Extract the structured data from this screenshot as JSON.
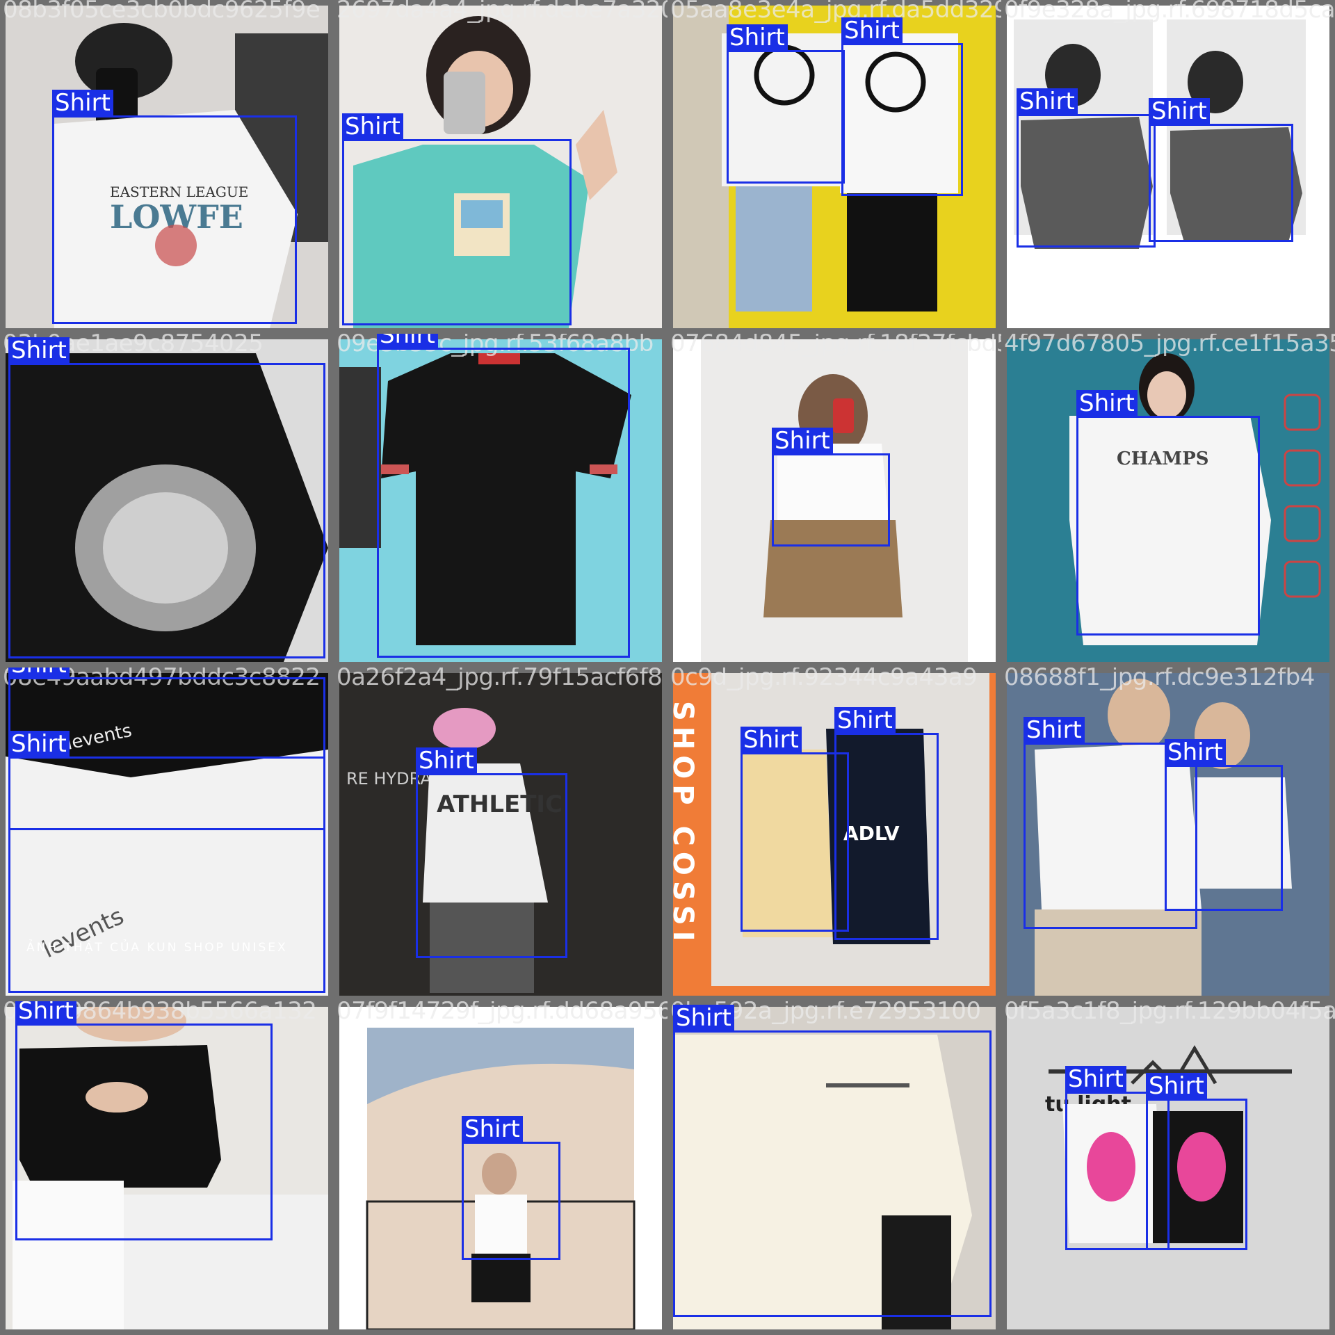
{
  "class_label": "Shirt",
  "box_color": "#1a2fe6",
  "tiles": [
    {
      "filename": "08b3f05ce3cb0bdc9625f9e",
      "objects": 1
    },
    {
      "filename": "2697da4a4_jpg.rf.debe7a320f0",
      "objects": 1
    },
    {
      "filename": "05aa8e3e4a_jpg.rf.da5dd329",
      "objects": 2
    },
    {
      "filename": "0f9e328a_jpg.rf.698718d5ca",
      "objects": 2
    },
    {
      "filename": "03b0ae1ae9c8754025",
      "objects": 1
    },
    {
      "filename": "09e3b55c_jpg.rf.53f68a8bb",
      "objects": 1
    },
    {
      "filename": "07684d845_jpg.rf.18f37fcbd5",
      "objects": 1
    },
    {
      "filename": "4f97d67805_jpg.rf.ce1f15a35f2",
      "objects": 1
    },
    {
      "filename": "08e49aabd497bddc3c8822",
      "objects": 2
    },
    {
      "filename": "0a26f2a4_jpg.rf.79f15acf6f8",
      "objects": 1
    },
    {
      "filename": "0c9d_jpg.rf.92344c9a43a9",
      "objects": 2
    },
    {
      "filename": "08688f1_jpg.rf.dc9e312fb4",
      "objects": 2
    },
    {
      "filename": "0f4c90864b938b5566a132",
      "objects": 1
    },
    {
      "filename": "07f9f14729f_jpg.rf.dd68a956",
      "objects": 1
    },
    {
      "filename": "0ba592a_jpg.rf.e72953100",
      "objects": 1
    },
    {
      "filename": "0f5a3c1f8_jpg.rf.129bb04f5a",
      "objects": 2
    }
  ],
  "overlay_text": {
    "tile1_print": "EASTERN LEAGUE",
    "tile1_logo": "LOWFE",
    "tile8_print": "CHAMPS",
    "tile9_brand": "levents",
    "tile9_caption": "ẢNH THẬT CỦA KUN SHOP UNISEX",
    "tile10_print": "ATHLETIC",
    "tile10_sign": "RE HYDRANT",
    "tile11_banner": "SHOP COSSI",
    "tile11_print": "ADLV",
    "tile16_sign": "tu light"
  }
}
